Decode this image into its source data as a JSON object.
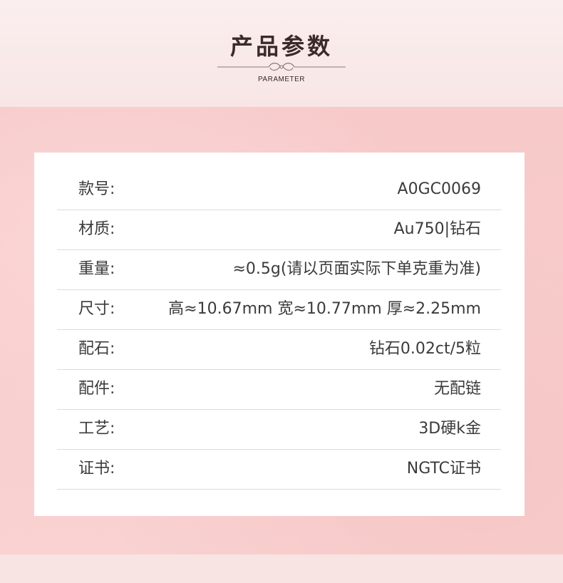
{
  "header": {
    "title": "产品参数",
    "subtitle": "PARAMETER"
  },
  "params": [
    {
      "label": "款号:",
      "value": "A0GC0069"
    },
    {
      "label": "材质:",
      "value": "Au750|钻石"
    },
    {
      "label": "重量:",
      "value": "≈0.5g(请以页面实际下单克重为准)"
    },
    {
      "label": "尺寸:",
      "value": "高≈10.67mm 宽≈10.77mm 厚≈2.25mm"
    },
    {
      "label": "配石:",
      "value": "钻石0.02ct/5粒"
    },
    {
      "label": "配件:",
      "value": "无配链"
    },
    {
      "label": "工艺:",
      "value": "3D硬k金"
    },
    {
      "label": "证书:",
      "value": "NGTC证书"
    }
  ],
  "colors": {
    "background_top": "#f9ebea",
    "background_pink": "#f7c9c9",
    "card": "#ffffff",
    "text": "#3b3b3b",
    "divider": "#dcdcdc"
  }
}
